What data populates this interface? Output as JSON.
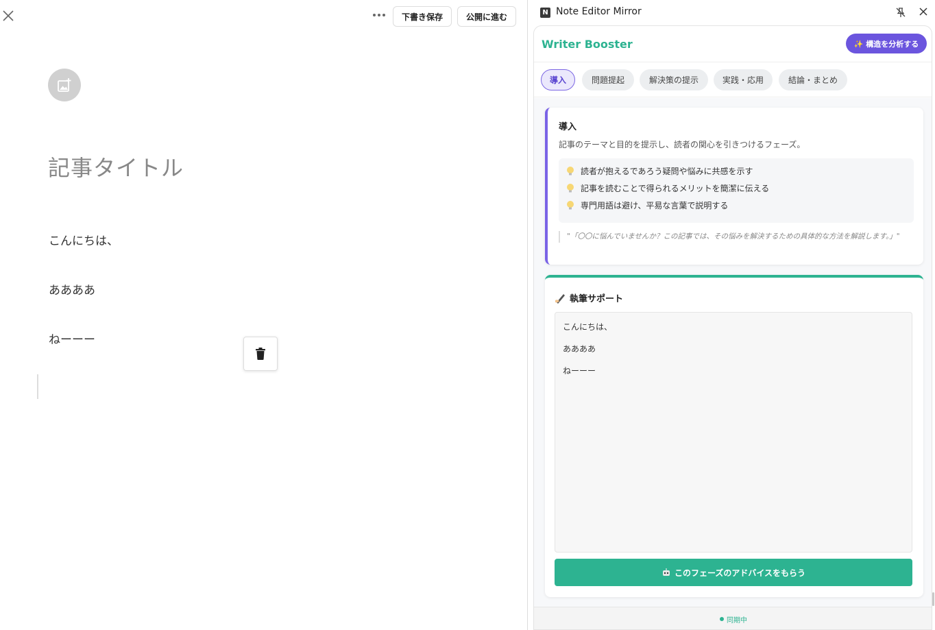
{
  "editor": {
    "draft_label": "下書き保存",
    "publish_label": "公開に進む",
    "title_placeholder": "記事タイトル",
    "body": [
      "こんにちは、",
      "ああああ",
      "ねーーー"
    ]
  },
  "panel": {
    "window_title": "Note Editor Mirror",
    "logo_letter": "N",
    "brand": "Writer Booster",
    "analyze_label": "✨ 構造を分析する",
    "tabs": [
      {
        "label": "導入",
        "active": true
      },
      {
        "label": "問題提起",
        "active": false
      },
      {
        "label": "解決策の提示",
        "active": false
      },
      {
        "label": "実践・応用",
        "active": false
      },
      {
        "label": "結論・まとめ",
        "active": false
      }
    ],
    "phase": {
      "title": "導入",
      "description": "記事のテーマと目的を提示し、読者の関心を引きつけるフェーズ。",
      "tips": [
        "読者が抱えるであろう疑問や悩みに共感を示す",
        "記事を読むことで得られるメリットを簡潔に伝える",
        "専門用語は避け、平易な言葉で説明する"
      ],
      "example": "\"「〇〇に悩んでいませんか？この記事では、その悩みを解決するための具体的な方法を解説します。」\""
    },
    "support": {
      "title": "執筆サポート",
      "mirror_lines": [
        "こんにちは、",
        "ああああ",
        "ねーーー"
      ],
      "advice_label": "このフェーズのアドバイスをもらう"
    },
    "status": "同期中",
    "colors": {
      "brand_green": "#2db391",
      "accent_purple": "#6b55de"
    }
  }
}
